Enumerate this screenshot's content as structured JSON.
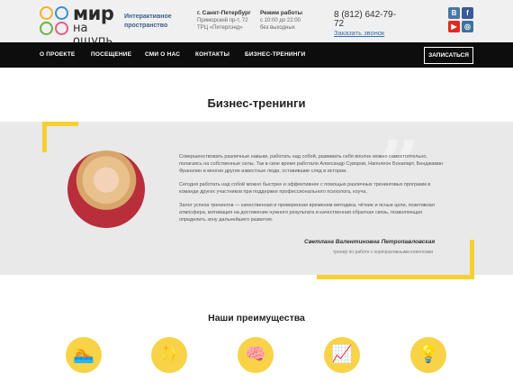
{
  "header": {
    "logo": {
      "text": "мир",
      "sub": "на ощупь"
    },
    "tagline": "Интерактивное пространство",
    "address": {
      "city": "г. Санкт-Петербург",
      "street": "Приморский пр-т, 72",
      "mall": "ТРЦ «Питерлэнд»"
    },
    "hours": {
      "title": "Режим работы",
      "line1": "с 10:00 до 22:00",
      "line2": "без выходных"
    },
    "phone": "8 (812) 642-79-72",
    "callback": "Заказать звонок",
    "social": [
      {
        "name": "vk",
        "glyph": "В",
        "color": "#4a76a8"
      },
      {
        "name": "facebook",
        "glyph": "f",
        "color": "#3b5998"
      },
      {
        "name": "youtube",
        "glyph": "▶",
        "color": "#e02a20"
      },
      {
        "name": "instagram",
        "glyph": "◎",
        "color": "#3f729b"
      }
    ]
  },
  "nav": {
    "items": [
      "О ПРОЕКТЕ",
      "ПОСЕЩЕНИЕ",
      "СМИ О НАС",
      "КОНТАКТЫ",
      "БИЗНЕС-ТРЕНИНГИ"
    ],
    "signup": "ЗАПИСАТЬСЯ"
  },
  "main": {
    "title": "Бизнес-тренинги",
    "paragraphs": [
      "Совершенствовать различные навыки, работать над собой, развивать себя вполне можно самостоятельно, полагаясь на собственные силы. Так в свое время работали Александр Суворов, Наполеон Бонапарт, Бенджамин Франклин и многие другие известные люди, оставившие след в истории.",
      "Сегодня работать над собой можно быстрее и эффективнее с помощью различных тренинговых программ в команде других участников при поддержке профессионального психолога, коуча.",
      "Залог успеха тренингов — качественная и проверенная временем методика, чёткие и ясные цели, позитивная атмосфера, мотивация на достижение нужного результата и качественная обратная связь, позволяющая определить зону дальнейшего развития."
    ],
    "signature": "Светлана Валентиновна Петропавловская",
    "role": "тренер по работе с корпоративными клиентами"
  },
  "advantages": {
    "title": "Наши преимущества",
    "icons": [
      {
        "name": "swimmer-icon",
        "glyph": "🏊"
      },
      {
        "name": "magic-wand-icon",
        "glyph": "✨"
      },
      {
        "name": "brain-icon",
        "glyph": "🧠"
      },
      {
        "name": "presentation-icon",
        "glyph": "📈"
      },
      {
        "name": "lightbulb-icon",
        "glyph": "💡"
      }
    ]
  }
}
